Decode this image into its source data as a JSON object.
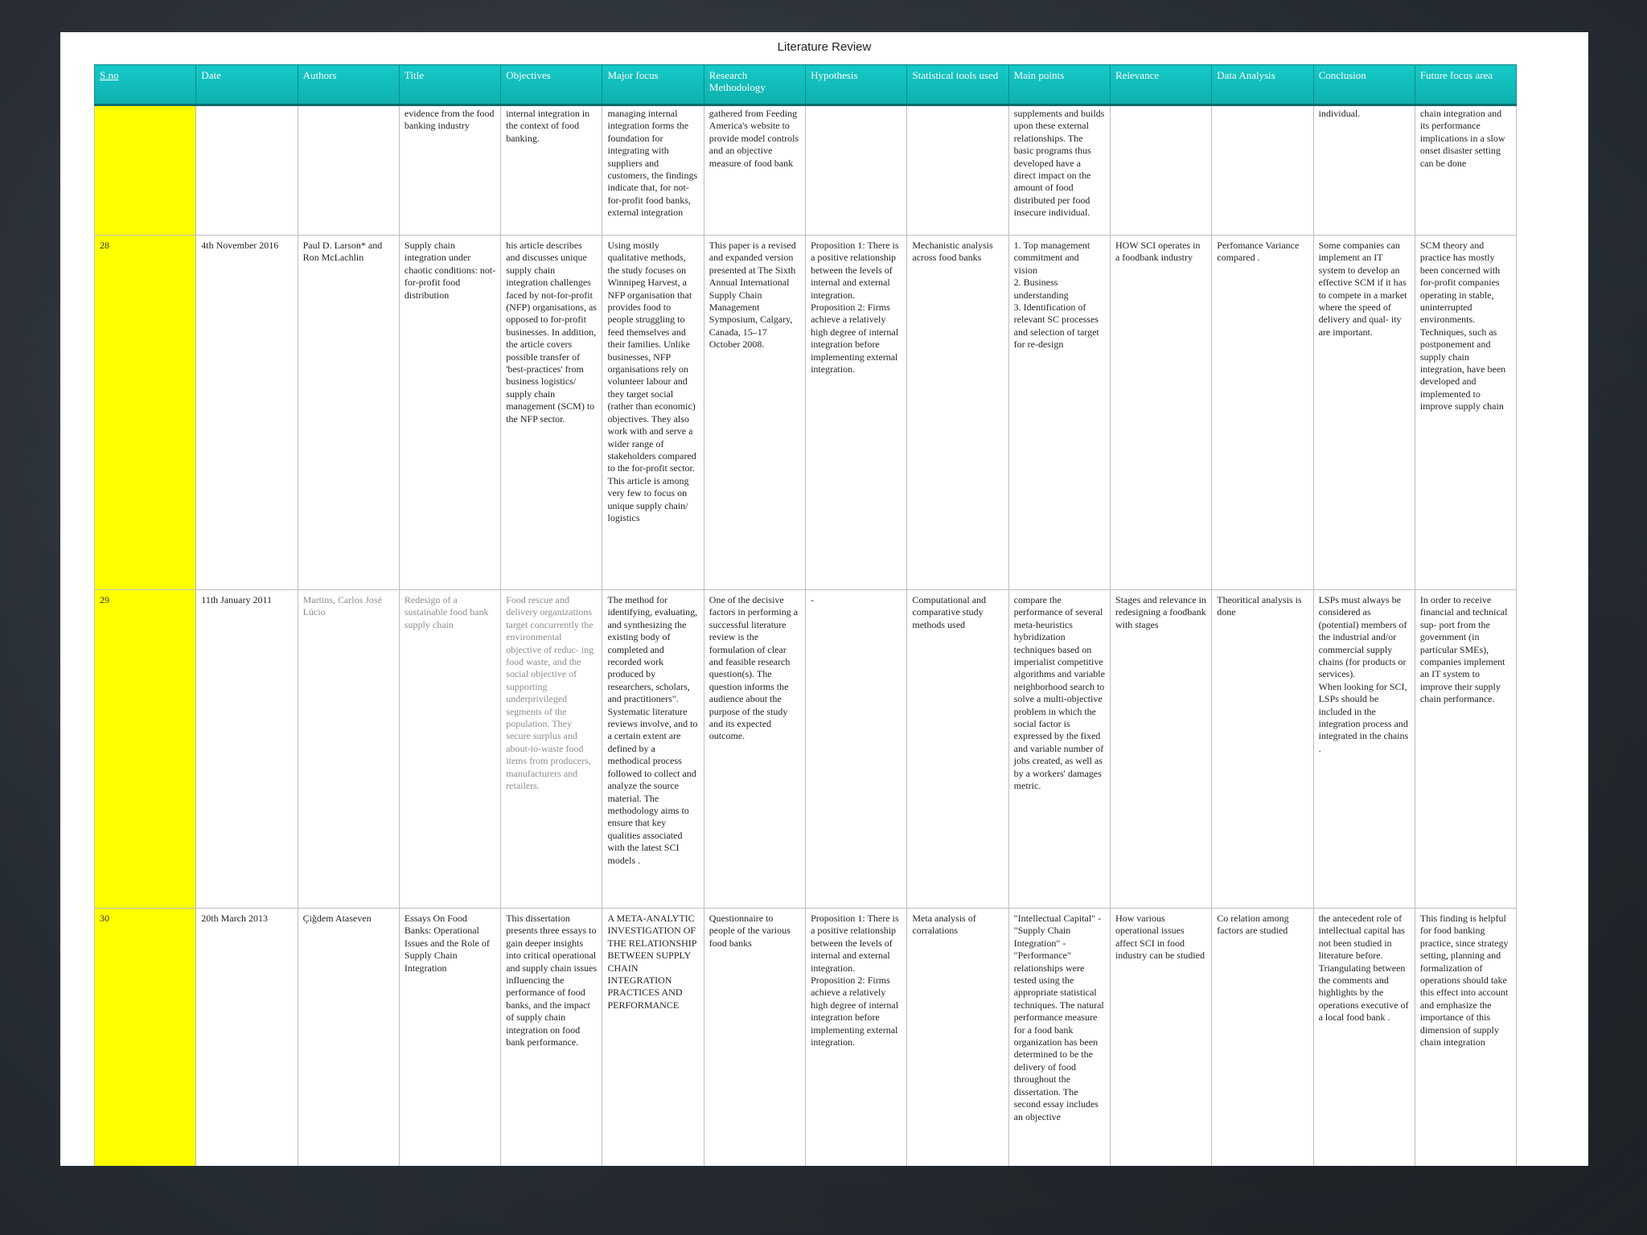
{
  "doc_title": "Literature Review",
  "headers": [
    "S.no",
    "Date",
    "Authors",
    "Title",
    "Objectives",
    "Major focus",
    "Research Methodology",
    "Hypothesis",
    "Statistical tools used",
    "Main points",
    "Relevance",
    "Data Analysis",
    "Conclusion",
    "Future focus area"
  ],
  "rows": [
    [
      "",
      "",
      "",
      "evidence from the food banking industry",
      "internal integration in the context of food banking.",
      "managing internal integration forms the foundation for integrating with suppliers and customers, the findings indicate that, for not-for-profit food banks, external integration",
      "gathered from Feeding America's website to provide model controls and an objective measure of food bank",
      "",
      "",
      "supplements and builds upon these external relationships. The basic programs thus developed have a direct impact on the amount of food distributed per food insecure individual.",
      "",
      "",
      "individual.",
      "chain integration and its performance implications in a slow onset disaster setting can be done"
    ],
    [
      "28",
      "4th November 2016",
      "Paul D. Larson* and Ron McLachlin",
      "Supply chain integration under chaotic conditions: not-for-profit food distribution",
      "his article describes and discusses unique supply chain integration challenges faced by not-for-profit (NFP) organisations, as opposed to for-profit businesses. In addition, the article covers possible transfer of 'best-practices' from business logistics/ supply chain management (SCM) to the NFP sector.",
      "Using mostly qualitative methods, the study focuses on Winnipeg Harvest, a NFP organisation that provides food to people struggling to feed themselves and their families. Unlike businesses, NFP organisations rely on volunteer labour and they target social (rather than economic) objectives. They also work with and serve a wider range of stakeholders compared to the for-profit sector. This article is among very few to focus on unique supply chain/ logistics",
      "This paper is a revised and expanded version presented at The Sixth Annual International Supply Chain Management Symposium, Calgary, Canada, 15–17 October 2008.",
      "Proposition 1: There is a positive relationship between the levels of internal and external integration. Proposition 2: Firms achieve a relatively high degree of internal integration before implementing external integration.",
      "Mechanistic analysis across food banks",
      "1. Top management commitment and vision\n2. Business understanding\n3. Identification of relevant SC processes and selection of target for re-design",
      "HOW SCI operates in a foodbank industry",
      "Perfomance Variance compared .",
      "Some companies can implement an IT system to develop an effective SCM if it has to compete in a market where the speed of delivery and qual- ity are important.",
      "SCM theory and practice has mostly been concerned with for-profit companies operating in stable, uninterrupted environments. Techniques, such as postponement and supply chain integration, have been developed and implemented to improve supply chain"
    ],
    [
      "29",
      "11th January 2011",
      "Martins, Carlos José Lúcio",
      "Redesign of a sustainable food bank supply chain",
      "Food rescue and delivery organizations target concurrently the environmental objective of reduc- ing food waste, and the social objective of supporting underprivileged segments of the population. They secure surplus and about-to-waste food items from producers, manufacturers and retailers.",
      "The method for identifying, evaluating, and synthesizing the existing body of completed and recorded work produced by researchers, scholars, and practitioners\". Systematic literature reviews involve, and to a certain extent are defined by a methodical process followed to collect and analyze the source material. The methodology aims to ensure that key qualities associated with the latest SCI models .",
      "One of the decisive factors in performing a successful literature review is the formulation of clear and feasible research question(s). The question informs the audience about the purpose of the study and its expected outcome.",
      "-",
      "Computational and comparative study methods used",
      "compare the performance of several meta-heuristics hybridization techniques based on imperialist competitive algorithms and variable neighborhood search to solve a multi-objective problem in which the social factor is expressed by the fixed and variable number of jobs created, as well as by a workers' damages metric.",
      "Stages and relevance in redesigning a foodbank with stages",
      "Theoritical analysis is done",
      "LSPs must always be considered as (potential) members of the industrial and/or commercial supply chains (for products or services).\n When looking for SCI, LSPs should be included in the integration process and integrated in the chains .",
      "In order to receive financial and technical sup- port from the government (in particular SMEs), companies implement an IT system to improve their supply chain performance."
    ],
    [
      "30",
      "20th March 2013",
      "Çiğdem Ataseven",
      "Essays On Food Banks: Operational Issues and the Role of Supply Chain Integration",
      "This dissertation presents three essays to gain deeper insights into critical operational and supply chain issues influencing the performance of food banks, and the impact of supply chain integration on food bank performance.",
      "A META-ANALYTIC INVESTIGATION OF THE RELATIONSHIP BETWEEN SUPPLY CHAIN INTEGRATION PRACTICES AND PERFORMANCE",
      "Questionnaire to people of the various food banks",
      "Proposition 1: There is a positive relationship between the levels of internal and external integration. Proposition 2: Firms achieve a relatively high degree of internal integration before implementing external integration.",
      "Meta analysis of corralations",
      "\"Intellectual Capital\" - \"Supply Chain Integration\" - \"Performance\" relationships were tested using the appropriate statistical techniques. The natural performance measure for a food bank organization has been determined to be the delivery of food throughout the dissertation. The second essay includes an objective",
      "How various operational issues affect SCI in food industry can be studied",
      "Co relation among factors are studied",
      "the antecedent role of intellectual capital has not been studied in literature before. Triangulating between the comments and highlights by the operations executive of a local food bank .",
      "This finding is helpful for food banking practice, since strategy setting, planning and formalization of operations should take this effect into account and emphasize the importance of this dimension of supply chain integration"
    ]
  ]
}
